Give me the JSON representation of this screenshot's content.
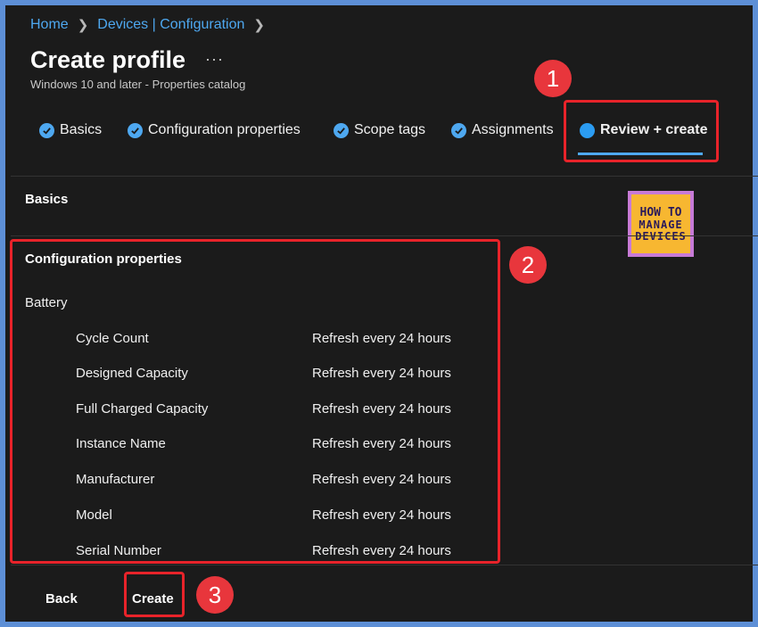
{
  "breadcrumb": [
    "Home",
    "Devices | Configuration"
  ],
  "header": {
    "title": "Create profile",
    "more": "···",
    "subtitle": "Windows 10 and later - Properties catalog"
  },
  "tabs": [
    {
      "label": "Basics",
      "state": "complete"
    },
    {
      "label": "Configuration properties",
      "state": "complete"
    },
    {
      "label": "Scope tags",
      "state": "complete"
    },
    {
      "label": "Assignments",
      "state": "complete"
    },
    {
      "label": "Review + create",
      "state": "active"
    }
  ],
  "sections": {
    "basics": "Basics",
    "config": "Configuration properties",
    "group": "Battery"
  },
  "rows": [
    {
      "name": "Cycle Count",
      "value": "Refresh every 24 hours"
    },
    {
      "name": "Designed Capacity",
      "value": "Refresh every 24 hours"
    },
    {
      "name": "Full Charged Capacity",
      "value": "Refresh every 24 hours"
    },
    {
      "name": "Instance Name",
      "value": "Refresh every 24 hours"
    },
    {
      "name": "Manufacturer",
      "value": "Refresh every 24 hours"
    },
    {
      "name": "Model",
      "value": "Refresh every 24 hours"
    },
    {
      "name": "Serial Number",
      "value": "Refresh every 24 hours"
    }
  ],
  "footer": {
    "back": "Back",
    "create": "Create"
  },
  "annotations": [
    "1",
    "2",
    "3"
  ],
  "logo": {
    "line1": "HOW TO",
    "line2": "MANAGE",
    "line3": "DEVICES"
  },
  "colors": {
    "accent": "#4ea8f0",
    "annotation": "#e8232a",
    "frame": "#5d8fd6",
    "background": "#1b1b1b"
  }
}
